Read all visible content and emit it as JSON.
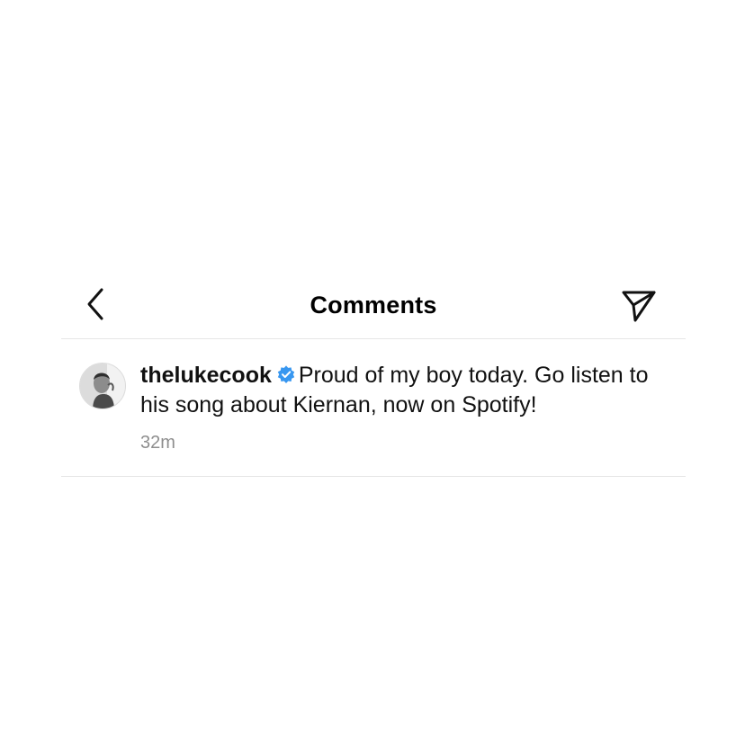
{
  "header": {
    "title": "Comments",
    "back_icon": "chevron-left-icon",
    "share_icon": "paper-plane-icon"
  },
  "comment": {
    "username": "thelukecook",
    "verified": true,
    "text": "Proud of my boy today. Go listen to his song about Kiernan, now on Spotify!",
    "timestamp": "32m"
  },
  "colors": {
    "verified_badge": "#3897f0",
    "divider": "#e6e6e6",
    "timestamp": "#8e8e8e"
  }
}
